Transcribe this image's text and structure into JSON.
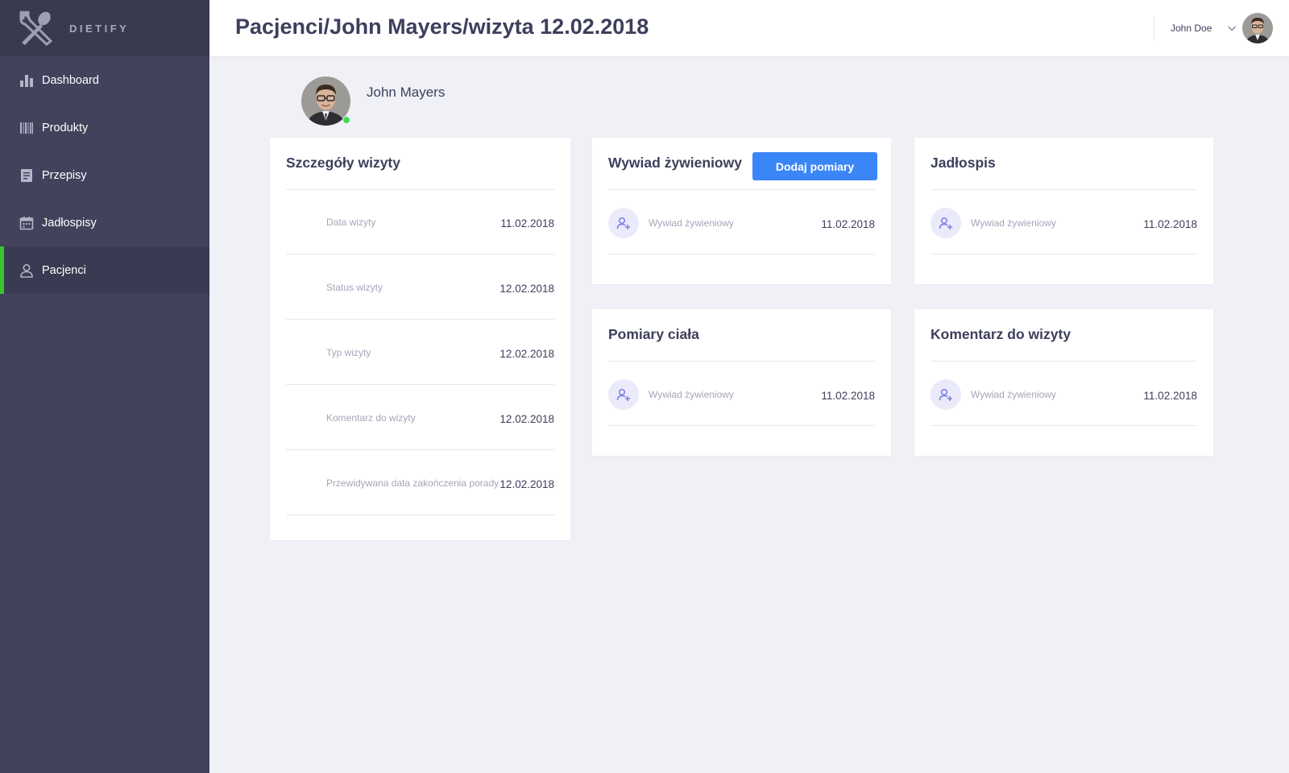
{
  "brand": {
    "name": "DIETIFY",
    "logo_icon": "fork-spoon-icon"
  },
  "sidebar": {
    "items": [
      {
        "label": "Dashboard",
        "icon": "bar-chart-icon"
      },
      {
        "label": "Produkty",
        "icon": "barcode-icon"
      },
      {
        "label": "Przepisy",
        "icon": "recipe-icon"
      },
      {
        "label": "Jadłospisy",
        "icon": "calendar-icon"
      },
      {
        "label": "Pacjenci",
        "icon": "user-icon",
        "active": true
      }
    ],
    "active_color": "#38c42d"
  },
  "header": {
    "title": "Pacjenci/John Mayers/wizyta 12.02.2018",
    "user_name": "John Doe"
  },
  "patient": {
    "name": "John Mayers",
    "status_color": "#3ddc5e"
  },
  "details_card": {
    "title": "Szczegóły wizyty",
    "rows": [
      {
        "label": "Data wizyty",
        "value": "11.02.2018"
      },
      {
        "label": "Status wizyty",
        "value": "12.02.2018"
      },
      {
        "label": "Typ wizyty",
        "value": "12.02.2018"
      },
      {
        "label": "Komentarz do wizyty",
        "value": "12.02.2018"
      },
      {
        "label": "Przewidywana data zakończenia porady",
        "value": "12.02.2018"
      }
    ]
  },
  "interview_card": {
    "title": "Wywiad żywieniowy",
    "button_label": "Dodaj pomiary",
    "row": {
      "label": "Wywiad żywieniowy",
      "value": "11.02.2018"
    }
  },
  "menu_card": {
    "title": "Jadłospis",
    "row": {
      "label": "Wywiad żywieniowy",
      "value": "11.02.2018"
    }
  },
  "measurements_card": {
    "title": "Pomiary ciała",
    "row": {
      "label": "Wywiad żywieniowy",
      "value": "11.02.2018"
    }
  },
  "comment_card": {
    "title": "Komentarz do wizyty",
    "row": {
      "label": "Wywiad żywieniowy",
      "value": "11.02.2018"
    }
  },
  "colors": {
    "sidebar_bg": "#42425c",
    "primary_button": "#3a86f7",
    "page_bg": "#f0f1f6"
  }
}
